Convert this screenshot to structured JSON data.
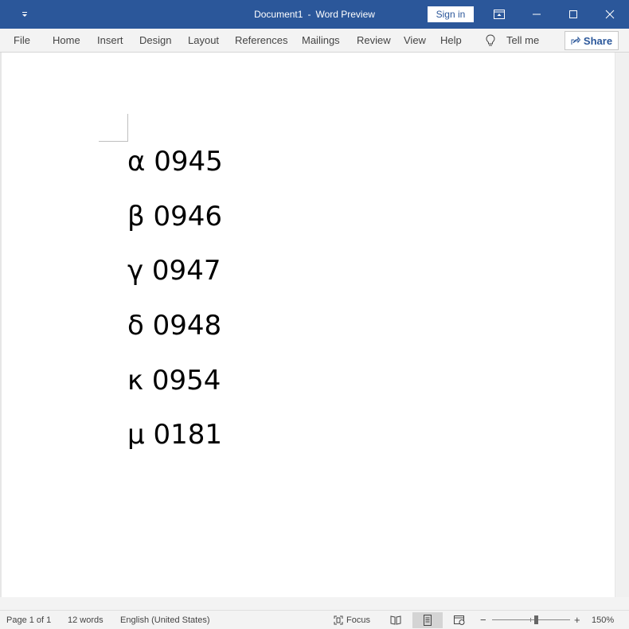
{
  "window": {
    "doc_title": "Document1",
    "separator": "-",
    "app_name": "Word Preview",
    "sign_in_label": "Sign in",
    "accent_color": "#2b579a"
  },
  "ribbon": {
    "tabs": [
      "File",
      "Home",
      "Insert",
      "Design",
      "Layout",
      "References",
      "Mailings",
      "Review",
      "View",
      "Help"
    ],
    "tell_me_label": "Tell me",
    "share_label": "Share"
  },
  "document": {
    "lines": [
      "α 0945",
      "β 0946",
      "γ 0947",
      "δ 0948",
      "κ 0954",
      "μ 0181"
    ]
  },
  "status": {
    "page": "Page 1 of 1",
    "words": "12 words",
    "language": "English (United States)",
    "focus_label": "Focus",
    "zoom": "150%"
  }
}
